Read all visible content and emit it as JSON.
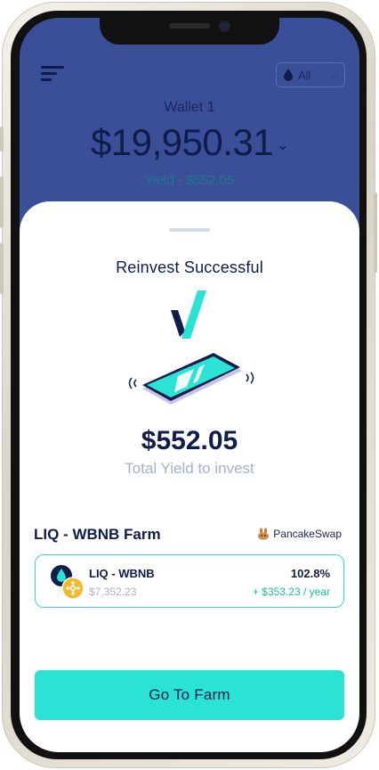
{
  "header": {
    "filter_label": "All",
    "wallet_name": "Wallet 1",
    "balance": "$19,950.31",
    "yield_text": "Yield - $552.05"
  },
  "sheet": {
    "title": "Reinvest Successful",
    "yield_amount": "$552.05",
    "yield_caption": "Total Yield to invest"
  },
  "farm": {
    "title": "LIQ - WBNB Farm",
    "provider": "PancakeSwap",
    "pool": {
      "name": "LIQ - WBNB",
      "value": "$7,352.23",
      "apy": "102.8%",
      "yearly": "+ $353.23 / year"
    }
  },
  "cta": {
    "label": "Go To Farm"
  },
  "colors": {
    "navy": "#0f1d4a",
    "header_bg": "#3a4f98",
    "accent": "#2ae3d4",
    "positive": "#1fbf9a",
    "muted": "#a6b0cc"
  },
  "icons": [
    "menu-icon",
    "droplet-icon",
    "chevron-down-icon",
    "logo-check-icon",
    "phone-illustration",
    "pancake-bunny-icon",
    "liq-token-icon",
    "bnb-token-icon"
  ]
}
